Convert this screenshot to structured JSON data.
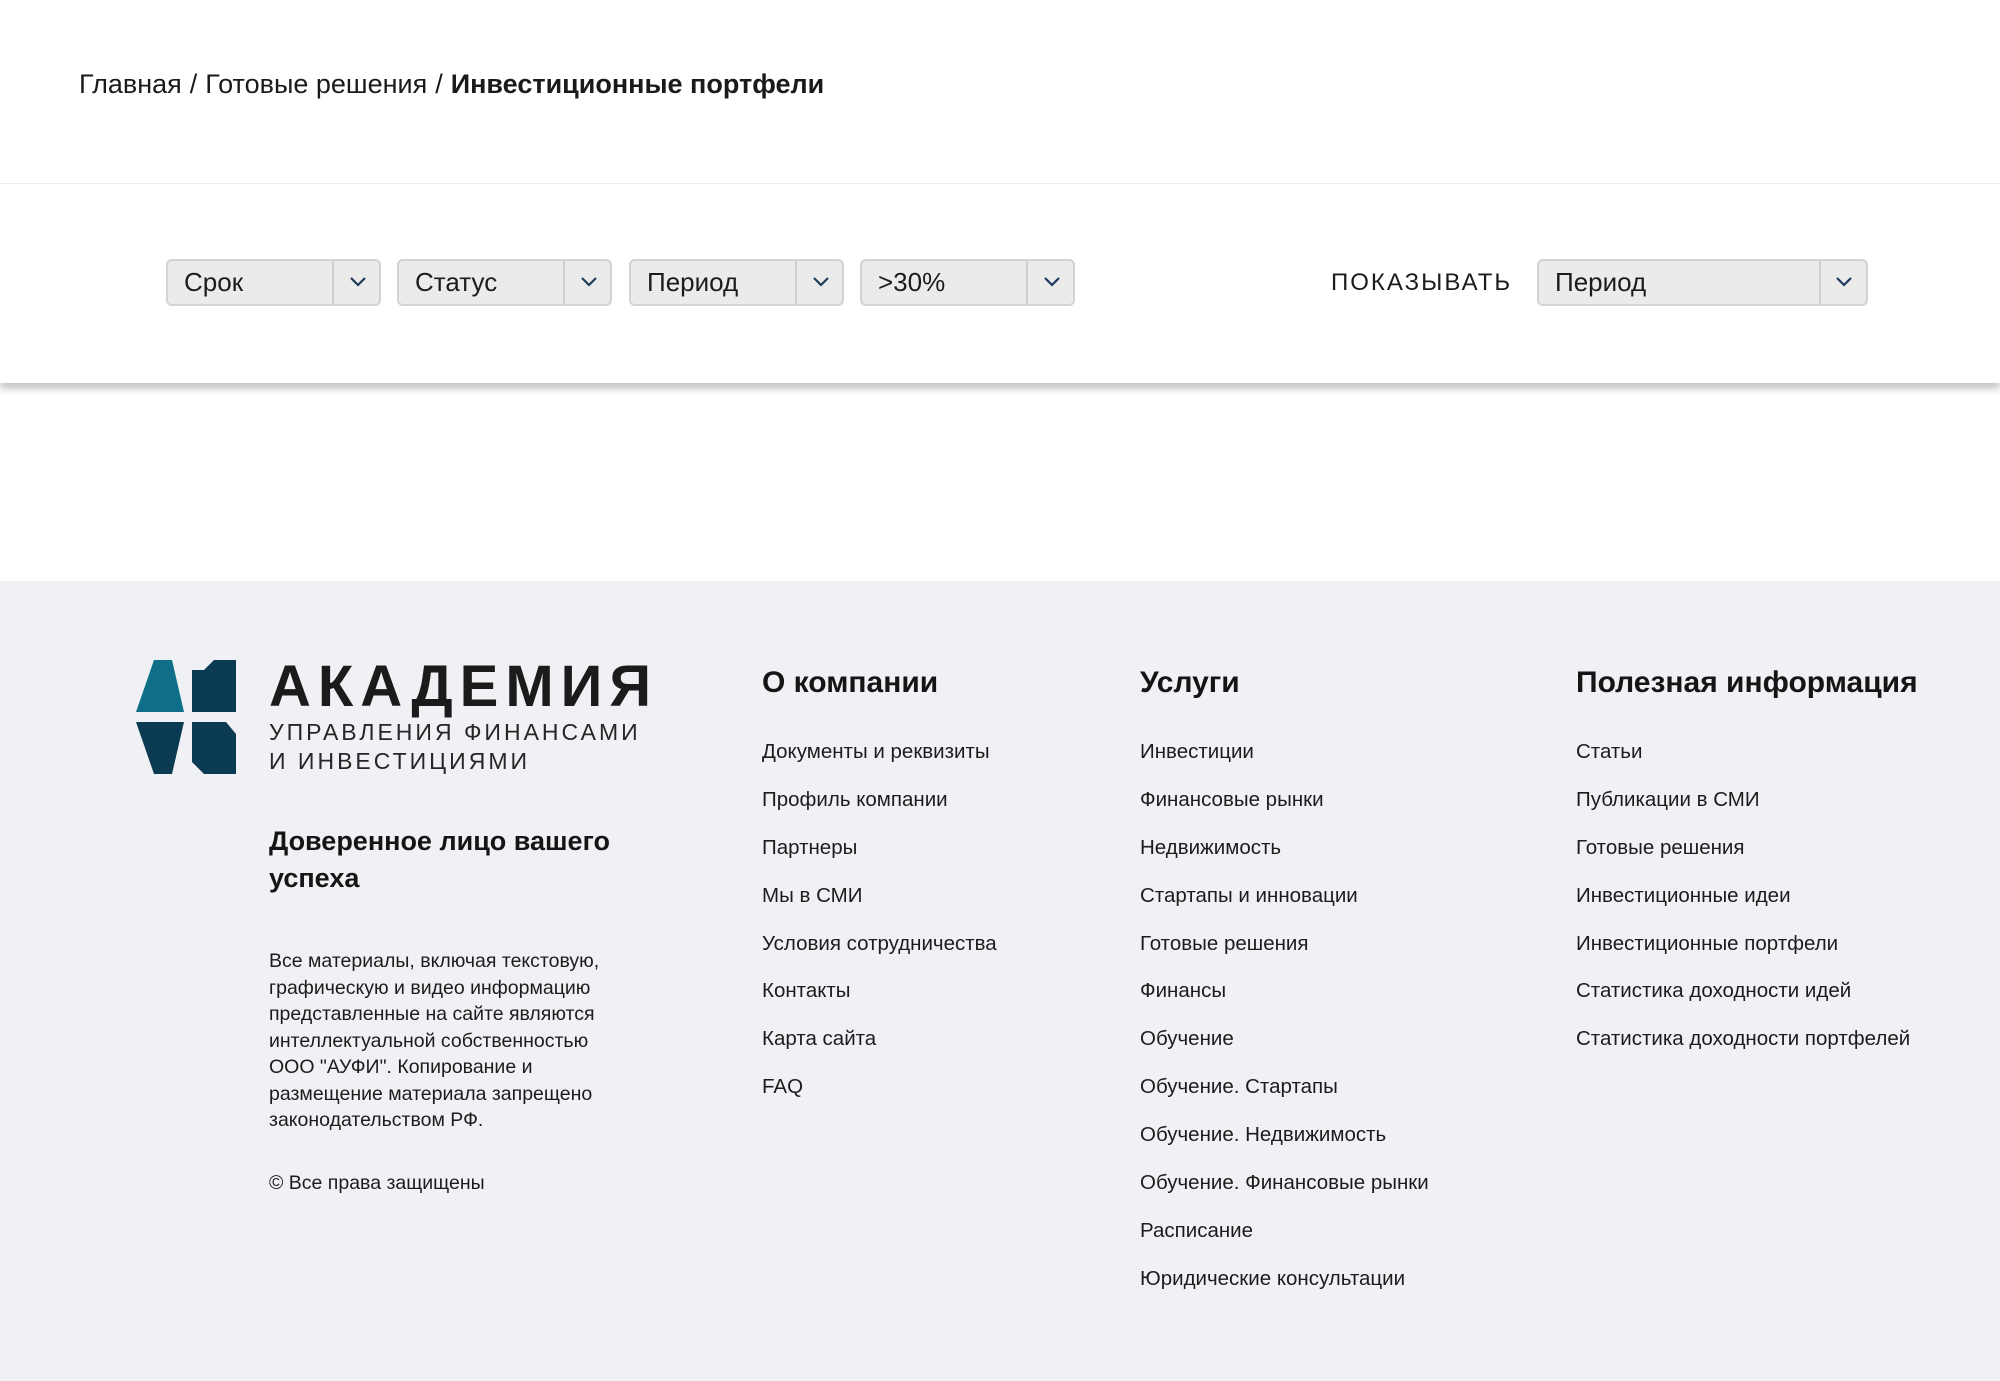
{
  "breadcrumb": {
    "items": [
      "Главная",
      "Готовые решения"
    ],
    "separator": "/",
    "current": "Инвестиционные портфели"
  },
  "filters": {
    "selects": [
      {
        "value": "Срок"
      },
      {
        "value": "Статус"
      },
      {
        "value": "Период"
      },
      {
        "value": ">30%"
      }
    ],
    "show_label": "ПОКАЗЫВАТЬ",
    "show_select": {
      "value": "Период"
    }
  },
  "footer": {
    "logo": {
      "name": "АКАДЕМИЯ",
      "subtitle_line1": "УПРАВЛЕНИЯ ФИНАНСАМИ",
      "subtitle_line2": "И ИНВЕСТИЦИЯМИ",
      "colors": {
        "light": "#0f6e88",
        "dark": "#0b3a53"
      }
    },
    "tagline": "Доверенное лицо вашего успеха",
    "legal": "Все материалы, включая текстовую, графическую и видео информацию представленные на сайте являются интеллектуальной собственностью ООО \"АУФИ\". Копирование и размещение материала запрещено законодательством РФ.",
    "copyright": "© Все права защищены",
    "columns": {
      "about": {
        "title": "О компании",
        "links": [
          "Документы и реквизиты",
          "Профиль компании",
          "Партнеры",
          "Мы в СМИ",
          "Условия сотрудничества",
          "Контакты",
          "Карта сайта",
          "FAQ"
        ]
      },
      "services": {
        "title": "Услуги",
        "links": [
          "Инвестиции",
          "Финансовые рынки",
          "Недвижимость",
          "Стартапы и инновации",
          "Готовые решения",
          "Финансы",
          "Обучение",
          "Обучение. Стартапы",
          "Обучение. Недвижимость",
          "Обучение. Финансовые рынки",
          "Расписание",
          "Юридические консультации"
        ]
      },
      "info": {
        "title": "Полезная информация",
        "links": [
          "Статьи",
          "Публикации в СМИ",
          "Готовые решения",
          "Инвестиционные идеи",
          "Инвестиционные портфели",
          "Статистика доходности идей",
          "Статистика доходности портфелей"
        ]
      }
    }
  },
  "colors": {
    "footer_bg": "#f0f1f4",
    "select_bg": "#ebebeb",
    "chevron": "#1d3a5a"
  },
  "icons": {
    "select_arrow": "chevron-down-icon",
    "logo": "academy-logo-icon"
  }
}
